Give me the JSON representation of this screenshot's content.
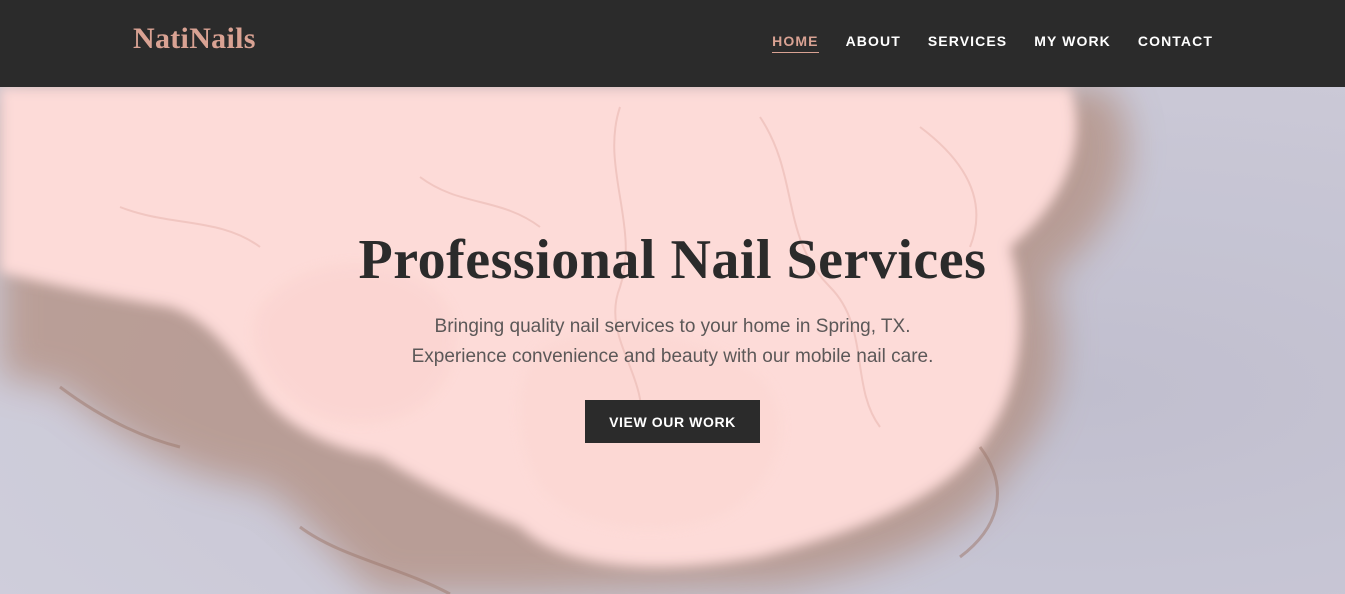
{
  "nav": {
    "brand": "NatiNails",
    "links": [
      {
        "label": "HOME",
        "active": true
      },
      {
        "label": "ABOUT",
        "active": false
      },
      {
        "label": "SERVICES",
        "active": false
      },
      {
        "label": "MY WORK",
        "active": false
      },
      {
        "label": "CONTACT",
        "active": false
      }
    ]
  },
  "hero": {
    "title": "Professional Nail Services",
    "subtitle_line1": "Bringing quality nail services to your home in Spring, TX.",
    "subtitle_line2": "Experience convenience and beauty with our mobile nail care.",
    "cta_label": "VIEW OUR WORK"
  },
  "colors": {
    "navbar_bg": "#2b2b2b",
    "accent": "#d9a293",
    "hero_pink": "#fdd5d2",
    "hero_lavender": "#c4c2d2",
    "hero_brown": "#a87a68",
    "title_text": "#2b2b2b",
    "subtitle_text": "#5c5858"
  }
}
